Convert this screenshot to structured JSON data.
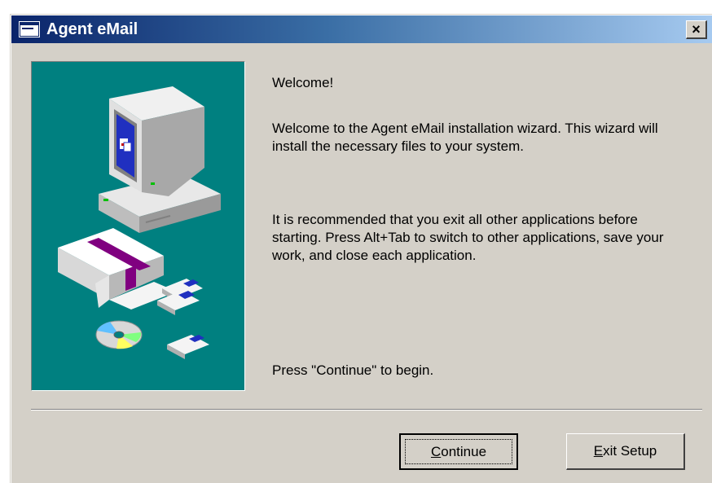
{
  "window": {
    "title": "Agent eMail",
    "close_icon": "close-icon",
    "close_glyph": "×"
  },
  "content": {
    "heading": "Welcome!",
    "intro": "Welcome to the Agent eMail installation wizard.  This wizard will install the necessary files to your system.",
    "recommendation": "It is recommended that you exit all other applications before starting.  Press Alt+Tab to switch to other applications, save your work, and close each application.",
    "instruction": "Press \"Continue\" to begin."
  },
  "buttons": {
    "continue": {
      "mnemonic": "C",
      "rest": "ontinue"
    },
    "exit": {
      "mnemonic": "E",
      "rest": "xit Setup"
    }
  },
  "colors": {
    "panel_background": "#008080",
    "title_gradient_start": "#0a246a",
    "title_gradient_end": "#a6caf0",
    "window_face": "#d4d0c8"
  },
  "icons": [
    "app-icon",
    "close-icon",
    "computer-icon",
    "software-box-icon",
    "floppy-disk-icon",
    "cd-rom-icon"
  ]
}
